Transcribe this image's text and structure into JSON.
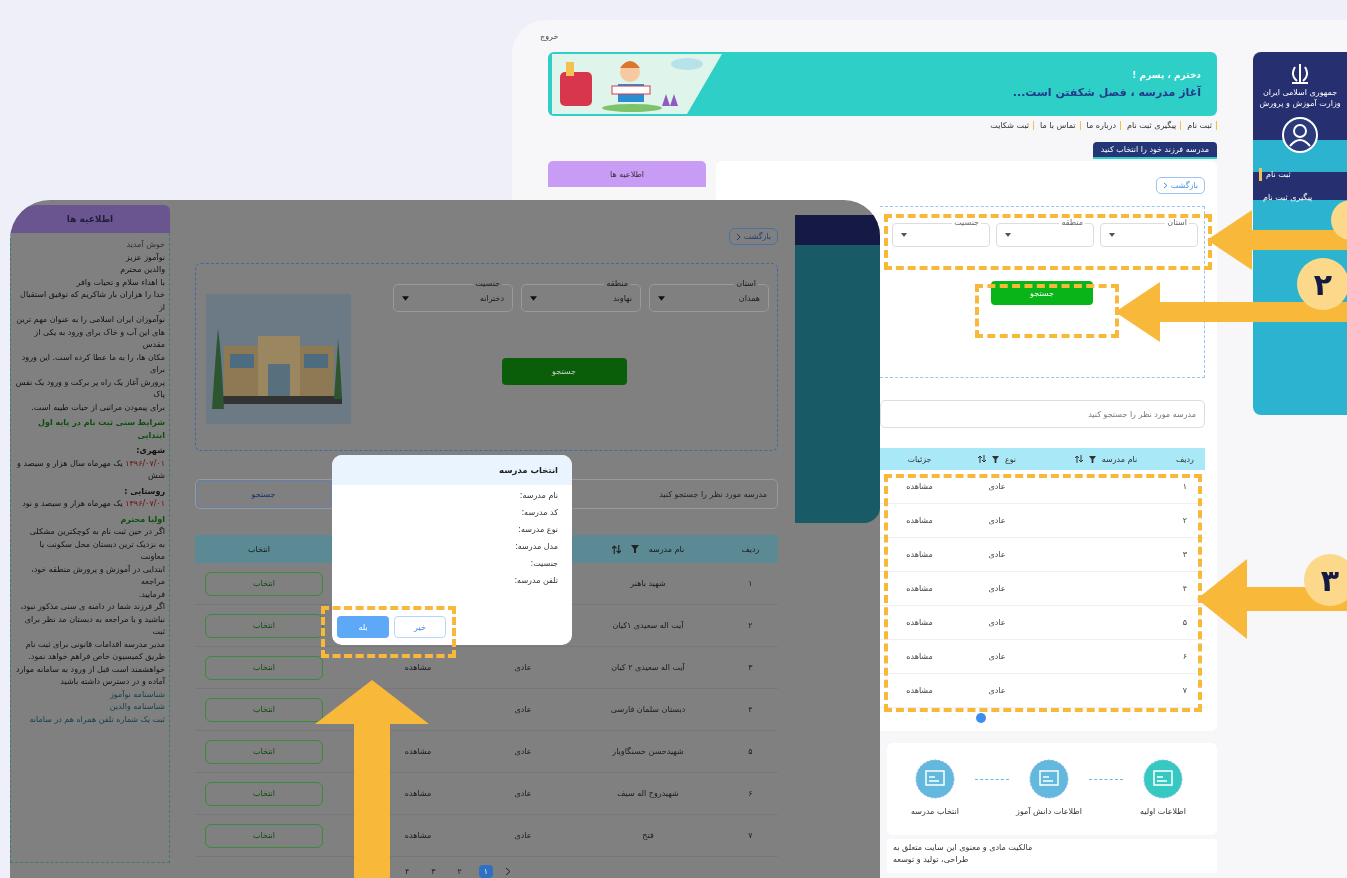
{
  "back_page": {
    "exit_link": "خروج",
    "banner": {
      "line_1": "دخترم ، پسرم !",
      "line_2": "آغاز مدرسه ، فصل شکفتن است..."
    },
    "nav": [
      "ثبت نام",
      "پیگیری ثبت نام",
      "درباره ما",
      "تماس با ما",
      "ثبت شکایت"
    ],
    "section_title": "مدرسه فرزند خود را انتخاب کنید",
    "announcements_title": "اطلاعیه ها",
    "back_button": "بازگشت",
    "fields": [
      {
        "label": "استان"
      },
      {
        "label": "منطقه"
      },
      {
        "label": "جنسیت"
      }
    ],
    "search_button": "جستجو",
    "school_search": {
      "placeholder": "مدرسه مورد نظر را جستجو کنید"
    },
    "table": {
      "columns": [
        "ردیف",
        "نام مدرسه",
        "نوع",
        "جزئیات"
      ],
      "rows": [
        {
          "number": "۱",
          "type": "عادی",
          "details": "مشاهده"
        },
        {
          "number": "۲",
          "type": "عادی",
          "details": "مشاهده"
        },
        {
          "number": "۳",
          "type": "عادی",
          "details": "مشاهده"
        },
        {
          "number": "۴",
          "type": "عادی",
          "details": "مشاهده"
        },
        {
          "number": "۵",
          "type": "عادی",
          "details": "مشاهده"
        },
        {
          "number": "۶",
          "type": "عادی",
          "details": "مشاهده"
        },
        {
          "number": "۷",
          "type": "عادی",
          "details": "مشاهده"
        }
      ]
    },
    "steps": [
      {
        "label": "اطلاعات اولیه"
      },
      {
        "label": "اطلاعات دانش آموز"
      },
      {
        "label": "انتخاب مدرسه"
      }
    ],
    "footer": [
      "مالکیت مادی و معنوی این سایت متعلق به",
      "طراحی، تولید و توسعه"
    ],
    "sidebar": {
      "org_lines": [
        "جمهوری اسلامی ایران",
        "وزارت آموزش و پرورش"
      ],
      "items": [
        {
          "label": "ثبت نام",
          "selected": true
        },
        {
          "label": "پیگیری ثبت نام",
          "selected": false
        }
      ]
    }
  },
  "front_page": {
    "announcements": {
      "title": "اطلاعیه ها",
      "lines": [
        {
          "kind": "muted",
          "text": "خوش آمدید"
        },
        {
          "kind": "plain",
          "text": "نوآموز عزیز"
        },
        {
          "kind": "plain",
          "text": "والدین محترم"
        },
        {
          "kind": "plain",
          "text": "با اهداء سلام و تحیات وافر"
        },
        {
          "kind": "plain",
          "text": "خدا را هزاران بار شاکریم که توفیق استقبال از"
        },
        {
          "kind": "plain",
          "text": "نوآموزان ایران اسلامی را به عنوان مهم ترین"
        },
        {
          "kind": "plain",
          "text": "های این آب و خاک برای ورود به یکی از مقدس"
        },
        {
          "kind": "plain",
          "text": "مکان ها، را به ما عطا کرده است. این ورود برای"
        },
        {
          "kind": "plain",
          "text": "پرورش آغاز یک راه پر برکت و ورود یک نفس پاک"
        },
        {
          "kind": "plain",
          "text": "برای پیمودن مراتبی از حیات طیبه است."
        },
        {
          "kind": "heading",
          "text": "شرایط سنی ثبت نام در پایه اول ابتدایی"
        },
        {
          "kind": "subheading",
          "text": "شهری:"
        },
        {
          "kind": "dated",
          "date": "۱۳۹۶/۰۷/۰۱",
          "text": "یک مهرماه سال هزار و سیصد و"
        },
        {
          "kind": "plain",
          "text": "شش"
        },
        {
          "kind": "subheading",
          "text": "روستایی :"
        },
        {
          "kind": "dated",
          "date": "۱۳۹۶/۰۷/۰۱",
          "text": "یک مهرماه هزار و سیصد و نود"
        },
        {
          "kind": "heading",
          "text": "اولیا محترم"
        },
        {
          "kind": "plain",
          "text": "اگر در حین ثبت نام به کوچکترین مشکلی"
        },
        {
          "kind": "plain",
          "text": "به نزدیک ترین دبستان محل سکونت یا معاونت"
        },
        {
          "kind": "plain",
          "text": "ابتدایی در آموزش و پرورش منطقه خود، مراجعه"
        },
        {
          "kind": "plain",
          "text": "فرمایید."
        },
        {
          "kind": "plain",
          "text": "اگر فرزند شما در دامنه ی سنی مذکور نبود،"
        },
        {
          "kind": "plain",
          "text": "نباشید و با مراجعه به دبستان مد نظر برای ثبت"
        },
        {
          "kind": "plain",
          "text": "مدیر مدرسه اقدامات قانونی برای ثبت نام"
        },
        {
          "kind": "plain",
          "text": "طریق کمیسیون خاص فراهم خواهد نمود."
        },
        {
          "kind": "plain",
          "text": "خواهشمند است قبل از ورود به سامانه موارد"
        },
        {
          "kind": "plain",
          "text": "آماده و در دسترس داشته باشید"
        },
        {
          "kind": "link",
          "text": "شناسنامه نوآموز"
        },
        {
          "kind": "link",
          "text": "شناسنامه والدین"
        },
        {
          "kind": "link",
          "text": "ثبت یک شماره تلفن همراه هم در سامانه"
        }
      ]
    },
    "back_button": "بازگشت",
    "fields": [
      {
        "label": "استان",
        "value": "همدان"
      },
      {
        "label": "منطقه",
        "value": "نهاوند"
      },
      {
        "label": "جنسیت",
        "value": "دخترانه"
      }
    ],
    "search_button": "جستجو",
    "school_search": {
      "placeholder": "مدرسه مورد نظر را جستجو کنید",
      "button": "جستجو"
    },
    "table": {
      "columns": [
        "ردیف",
        "نام مدرسه",
        "انتخاب"
      ],
      "rows": [
        {
          "number": "۱",
          "name": "شهید باهنر",
          "select": "انتخاب"
        },
        {
          "number": "۲",
          "name": "آیت اله سعیدی ۱کیان",
          "select": "انتخاب"
        },
        {
          "number": "۳",
          "name": "آیت اله سعیدی ۲ کیان",
          "type": "عادی",
          "details": "مشاهده",
          "select": "انتخاب"
        },
        {
          "number": "۴",
          "name": "دبستان سلمان فارسی",
          "type": "عادی",
          "select": "انتخاب"
        },
        {
          "number": "۵",
          "name": "شهیدحسن حسنگاویار",
          "type": "عادی",
          "details": "مشاهده",
          "select": "انتخاب"
        },
        {
          "number": "۶",
          "name": "شهیدروح اله سیف",
          "type": "عادی",
          "details": "مشاهده",
          "select": "انتخاب"
        },
        {
          "number": "۷",
          "name": "فتح",
          "type": "عادی",
          "details": "مشاهده",
          "select": "انتخاب"
        }
      ]
    },
    "pagination": [
      {
        "label": "۱",
        "selected": true
      },
      {
        "label": "۲",
        "selected": false
      },
      {
        "label": "۳",
        "selected": false
      },
      {
        "label": "۴",
        "selected": false
      }
    ],
    "dialog": {
      "title": "انتخاب مدرسه",
      "fields": [
        "نام مدرسه:",
        "کد مدرسه:",
        "نوع مدرسه:",
        "مدل مدرسه:",
        "جنسیت:",
        "تلفن مدرسه:"
      ],
      "confirm": "بله",
      "cancel": "خیر"
    }
  },
  "callouts": [
    {
      "number": "۲"
    },
    {
      "number": "۳"
    }
  ]
}
